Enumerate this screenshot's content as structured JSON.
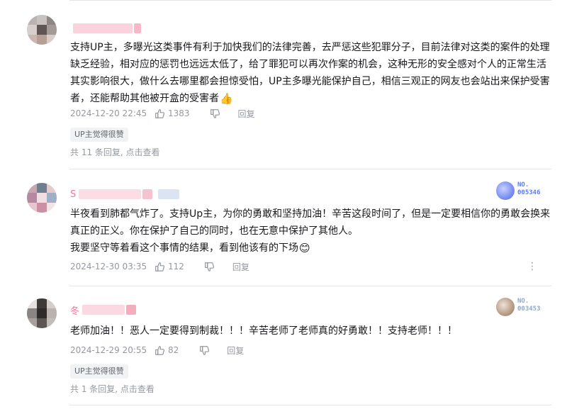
{
  "comments": [
    {
      "username": "",
      "content": "支持UP主，多曝光这类事件有利于加快我们的法律完善，去严惩这些犯罪分子，目前法律对这类的案件的处理缺乏经验，相对应的惩罚也远远太低了，给了罪犯可以再次作案的机会，这种无形的安全感对个人的正常生活其实影响很大，做什么去哪里都会担惊受怕，UP主多曝光能保护自己，相信三观正的网友也会站出来保护受害者，还能帮助其他被开盒的受害者",
      "emoji": "👍",
      "date": "2024-12-20 22:45",
      "likes": "1383",
      "reply_label": "回复",
      "badge": "UP主觉得很赞",
      "replies_prefix": "共 11 条回复, ",
      "replies_link": "点击查看"
    },
    {
      "username": "S",
      "content": "半夜看到肺都气炸了。支持Up主，为你的勇敢和坚持加油！辛苦这段时间了，但是一定要相信你的勇敢会换来真正的正义。你在保护了自己的同时，也在无意中保护了其他人。\n我要坚守等着看这个事情的结果，看到他该有的下场",
      "emoji": "😊",
      "date": "2024-12-30 03:35",
      "likes": "112",
      "reply_label": "回复",
      "fan_badge": {
        "line1": "NO.",
        "line2": "005346",
        "color": "#5c7cfa"
      },
      "more_icon": "more-vertical-icon"
    },
    {
      "username": "冬",
      "content": "老师加油！！恶人一定要得到制裁！！！辛苦老师了老师真的好勇敢！！支持老师！！！",
      "date": "2024-12-29 20:55",
      "likes": "82",
      "reply_label": "回复",
      "fan_badge": {
        "line1": "NO.",
        "line2": "003453",
        "color": "#8fa8c8"
      },
      "badge": "UP主觉得很赞",
      "replies_prefix": "共 1 条回复, ",
      "replies_link": "点击查看"
    }
  ],
  "colors": {
    "text": "#18191c",
    "meta": "#9499a0",
    "username_pink": "#fb7299",
    "divider": "#e3e5e7",
    "badge_bg": "#f1f2f3"
  },
  "icons": [
    "like-icon",
    "dislike-icon",
    "more-vertical-icon"
  ]
}
